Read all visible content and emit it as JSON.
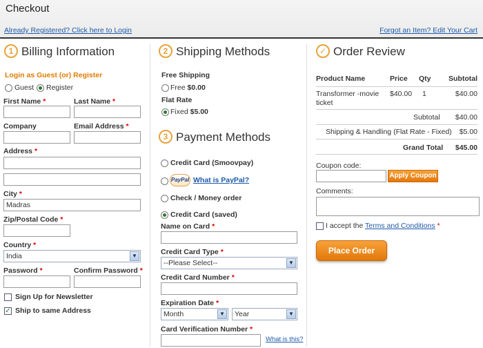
{
  "page": {
    "title": "Checkout",
    "already_registered_link": "Already Registered? Click here to Login",
    "forgot_link": "Forgot an Item? Edit Your Cart"
  },
  "billing": {
    "step_number": "1",
    "title": "Billing Information",
    "login_heading": "Login as Guest (or) Register",
    "guest_label": "Guest",
    "register_label": "Register",
    "first_name_label": "First Name",
    "last_name_label": "Last Name",
    "company_label": "Company",
    "email_label": "Email Address",
    "address_label": "Address",
    "city_label": "City",
    "city_value": "Madras",
    "zip_label": "Zip/Postal Code",
    "country_label": "Country",
    "country_value": "India",
    "password_label": "Password",
    "confirm_password_label": "Confirm Password",
    "newsletter_label": "Sign Up for Newsletter",
    "ship_same_label": "Ship to same Address",
    "required_mark": "*"
  },
  "shipping": {
    "step_number": "2",
    "title": "Shipping Methods",
    "free_heading": "Free Shipping",
    "free_option": "Free",
    "free_price": "$0.00",
    "flat_heading": "Flat Rate",
    "fixed_option": "Fixed",
    "fixed_price": "$5.00"
  },
  "payment": {
    "step_number": "3",
    "title": "Payment Methods",
    "cc_smoovpay": "Credit Card (Smoovpay)",
    "paypal_logo": "PayPal",
    "paypal_link": "What is PayPal?",
    "check_money": "Check / Money order",
    "cc_saved": "Credit Card (saved)",
    "name_on_card_label": "Name on Card",
    "cc_type_label": "Credit Card Type",
    "cc_type_value": "--Please Select--",
    "cc_number_label": "Credit Card Number",
    "expiration_label": "Expiration Date",
    "month_value": "Month",
    "year_value": "Year",
    "cvv_label": "Card Verification Number",
    "cvv_link": "What is this?"
  },
  "review": {
    "title": "Order Review",
    "columns": [
      "Product Name",
      "Price",
      "Qty",
      "Subtotal"
    ],
    "item": {
      "name": "Transformer -movie ticket",
      "price": "$40.00",
      "qty": "1",
      "subtotal": "$40.00"
    },
    "subtotal_label": "Subtotal",
    "subtotal_value": "$40.00",
    "shipping_label": "Shipping & Handling (Flat Rate - Fixed)",
    "shipping_value": "$5.00",
    "grand_total_label": "Grand Total",
    "grand_total_value": "$45.00",
    "coupon_label": "Coupon code:",
    "apply_coupon": "Apply Coupon",
    "comments_label": "Comments:",
    "terms_prefix": "I accept the",
    "terms_link": "Terms and Conditions",
    "place_order": "Place Order"
  },
  "colors": {
    "accent": "#e8a23a",
    "link": "#1e5aa8",
    "button": "#ef8a1e"
  }
}
